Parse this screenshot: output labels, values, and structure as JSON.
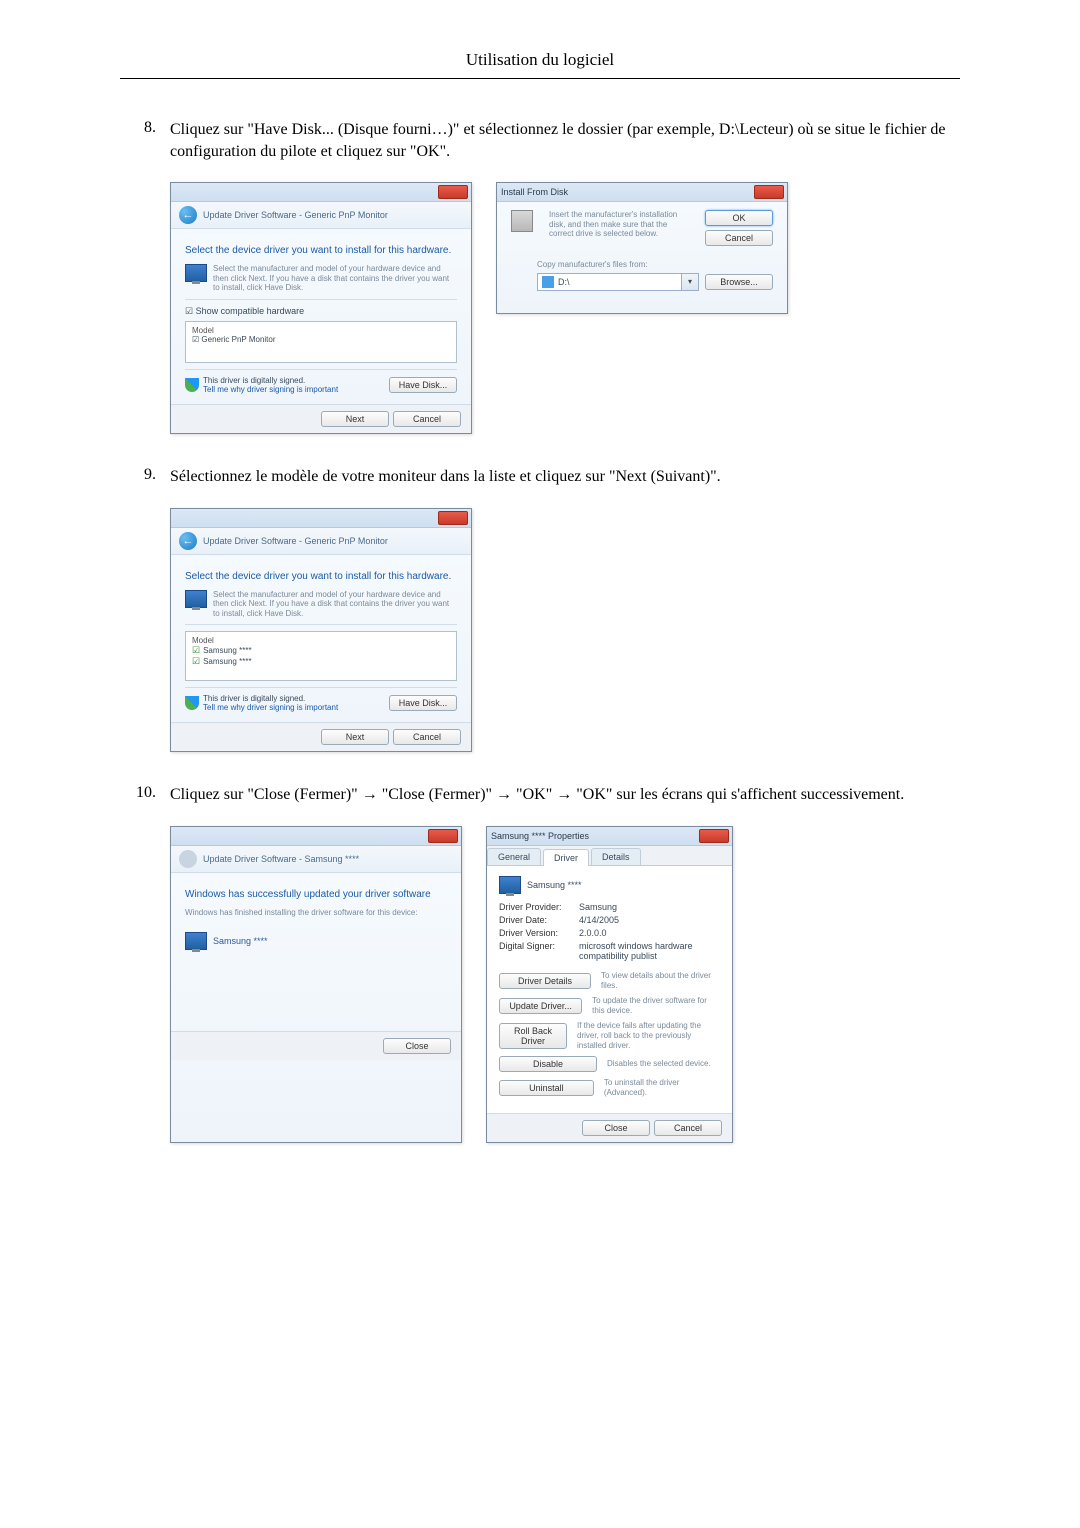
{
  "header": {
    "title": "Utilisation du logiciel"
  },
  "steps": {
    "s8": {
      "num": "8.",
      "text": "Cliquez sur \"Have Disk... (Disque fourni…)\" et sélectionnez le dossier (par exemple, D:\\Lecteur) où se situe le fichier de configuration du pilote et cliquez sur \"OK\"."
    },
    "s9": {
      "num": "9.",
      "text": "Sélectionnez le modèle de votre moniteur dans la liste et cliquez sur \"Next (Suivant)\"."
    },
    "s10": {
      "num": "10.",
      "text": "Cliquez sur \"Close (Fermer)\" → \"Close (Fermer)\" → \"OK\" → \"OK\" sur les écrans qui s'affichent successivement."
    }
  },
  "dlg8a": {
    "crumb": "Update Driver Software - Generic PnP Monitor",
    "heading": "Select the device driver you want to install for this hardware.",
    "sub": "Select the manufacturer and model of your hardware device and then click Next. If you have a disk that contains the driver you want to install, click Have Disk.",
    "compat_label": "Show compatible hardware",
    "model_label": "Model",
    "model_item": "Generic PnP Monitor",
    "signed": "This driver is digitally signed.",
    "tell_me": "Tell me why driver signing is important",
    "have_disk": "Have Disk...",
    "next": "Next",
    "cancel": "Cancel"
  },
  "dlg8b": {
    "title": "Install From Disk",
    "msg": "Insert the manufacturer's installation disk, and then make sure that the correct drive is selected below.",
    "ok": "OK",
    "cancel": "Cancel",
    "copy_label": "Copy manufacturer's files from:",
    "path": "D:\\",
    "browse": "Browse..."
  },
  "dlg9": {
    "crumb": "Update Driver Software - Generic PnP Monitor",
    "heading": "Select the device driver you want to install for this hardware.",
    "sub": "Select the manufacturer and model of your hardware device and then click Next. If you have a disk that contains the driver you want to install, click Have Disk.",
    "model_label": "Model",
    "m1": "Samsung ****",
    "m2": "Samsung ****",
    "signed": "This driver is digitally signed.",
    "tell_me": "Tell me why driver signing is important",
    "have_disk": "Have Disk...",
    "next": "Next",
    "cancel": "Cancel"
  },
  "dlg10a": {
    "crumb": "Update Driver Software - Samsung ****",
    "heading": "Windows has successfully updated your driver software",
    "sub": "Windows has finished installing the driver software for this device:",
    "device": "Samsung ****",
    "close": "Close"
  },
  "dlg10b": {
    "title": "Samsung **** Properties",
    "tabs": {
      "general": "General",
      "driver": "Driver",
      "details": "Details"
    },
    "device": "Samsung ****",
    "rows": {
      "provider_l": "Driver Provider:",
      "provider_v": "Samsung",
      "date_l": "Driver Date:",
      "date_v": "4/14/2005",
      "version_l": "Driver Version:",
      "version_v": "2.0.0.0",
      "signer_l": "Digital Signer:",
      "signer_v": "microsoft windows hardware compatibility publist"
    },
    "btns": {
      "details": "Driver Details",
      "details_d": "To view details about the driver files.",
      "update": "Update Driver...",
      "update_d": "To update the driver software for this device.",
      "rollback": "Roll Back Driver",
      "rollback_d": "If the device fails after updating the driver, roll back to the previously installed driver.",
      "disable": "Disable",
      "disable_d": "Disables the selected device.",
      "uninstall": "Uninstall",
      "uninstall_d": "To uninstall the driver (Advanced)."
    },
    "close": "Close",
    "cancel": "Cancel"
  }
}
